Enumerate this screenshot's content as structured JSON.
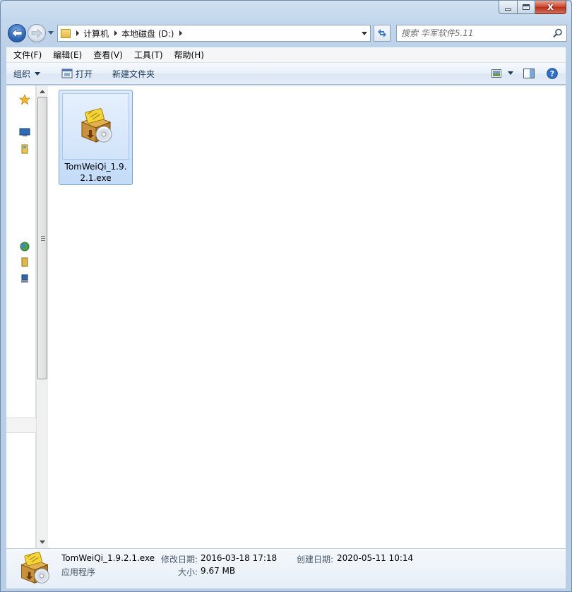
{
  "window": {
    "caption": {
      "minimize_icon": "minimize-icon",
      "maximize_icon": "maximize-icon",
      "close_icon": "close-icon",
      "close_glyph": "x"
    }
  },
  "navigation": {
    "address": {
      "crumbs": [
        {
          "label": "计算机"
        },
        {
          "label": "本地磁盘 (D:)"
        }
      ]
    },
    "search": {
      "placeholder": "搜索 华军软件5.11"
    }
  },
  "menu": {
    "items": [
      {
        "label": "文件(F)"
      },
      {
        "label": "编辑(E)"
      },
      {
        "label": "查看(V)"
      },
      {
        "label": "工具(T)"
      },
      {
        "label": "帮助(H)"
      }
    ]
  },
  "toolbar": {
    "organize_label": "组织",
    "open_label": "打开",
    "new_folder_label": "新建文件夹"
  },
  "files": [
    {
      "name": "TomWeiQi_1.9.2.1.exe",
      "icon": "installer-package-icon",
      "selected": true
    }
  ],
  "details": {
    "name": "TomWeiQi_1.9.2.1.exe",
    "type": "应用程序",
    "modified_label": "修改日期:",
    "modified_value": "2016-03-18 17:18",
    "created_label": "创建日期:",
    "created_value": "2020-05-11 10:14",
    "size_label": "大小:",
    "size_value": "9.67 MB"
  },
  "colors": {
    "window_frame": "#b9cfe7",
    "selection": "#c4dcf9",
    "selection_border": "#7da2ce",
    "toolbar_text": "#1e395b"
  }
}
